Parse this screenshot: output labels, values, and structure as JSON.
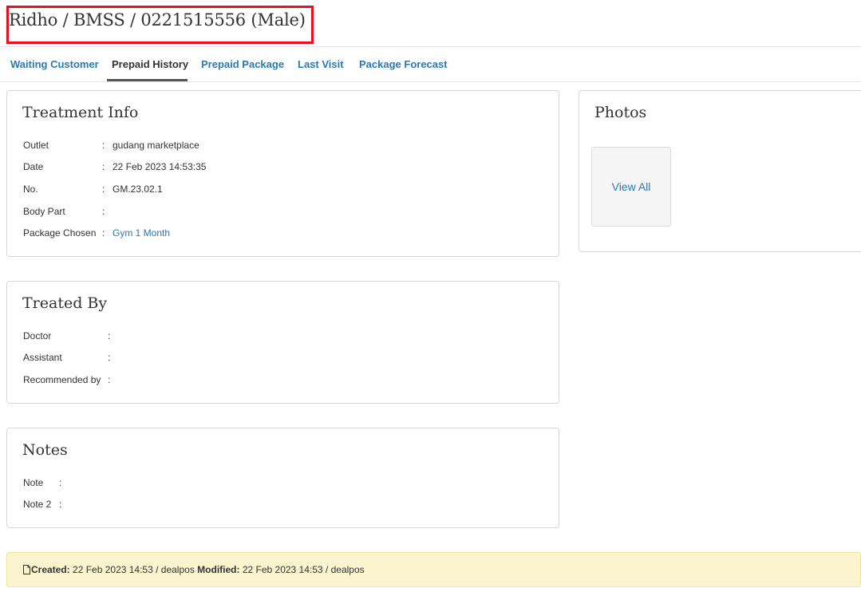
{
  "header": {
    "title": "Ridho / BMSS / 0221515556 (Male)"
  },
  "tabs": [
    {
      "label": "Waiting Customer"
    },
    {
      "label": "Prepaid History"
    },
    {
      "label": "Prepaid Package"
    },
    {
      "label": "Last Visit"
    },
    {
      "label": "Package Forecast"
    }
  ],
  "treatment_info": {
    "heading": "Treatment Info",
    "rows": [
      {
        "label": "Outlet",
        "value": "gudang marketplace"
      },
      {
        "label": "Date",
        "value": "22 Feb 2023 14:53:35"
      },
      {
        "label": "No.",
        "value": "GM.23.02.1"
      },
      {
        "label": "Body Part",
        "value": ""
      },
      {
        "label": "Package Chosen",
        "value": "Gym 1 Month"
      }
    ]
  },
  "treated_by": {
    "heading": "Treated By",
    "rows": [
      {
        "label": "Doctor",
        "value": ""
      },
      {
        "label": "Assistant",
        "value": ""
      },
      {
        "label": "Recommended by",
        "value": ""
      }
    ]
  },
  "notes": {
    "heading": "Notes",
    "rows": [
      {
        "label": "Note",
        "value": ""
      },
      {
        "label": "Note 2",
        "value": ""
      }
    ]
  },
  "photos": {
    "heading": "Photos",
    "view_all_label": "View All"
  },
  "footer": {
    "created_label": "Created:",
    "created_value": "22 Feb 2023 14:53 / dealpos",
    "modified_label": "Modified:",
    "modified_value": "22 Feb 2023 14:53 / dealpos"
  },
  "colon": ":",
  "colors": {
    "link": "#2a7ab0",
    "highlight": "#e8101f",
    "footer_bg": "#fcf3cf"
  }
}
